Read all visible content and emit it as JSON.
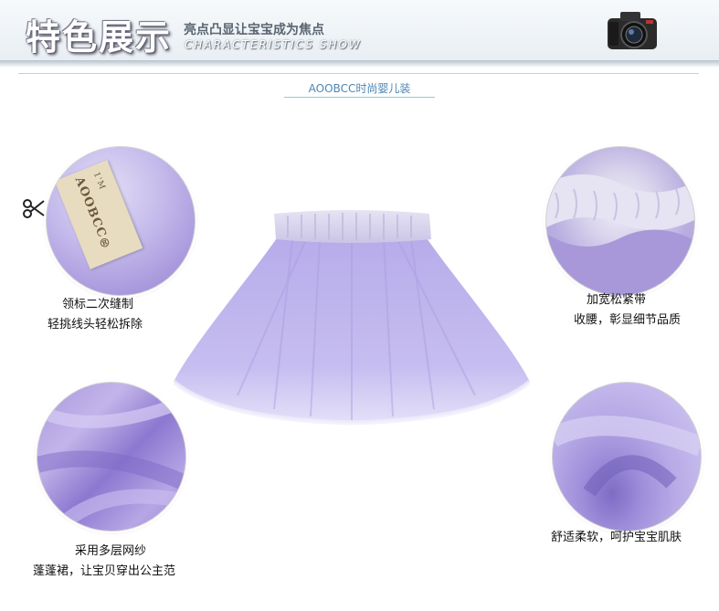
{
  "header": {
    "title": "特色展示",
    "subtitle_cn": "亮点凸显让宝宝成为焦点",
    "subtitle_en": "CHARACTERISTICS SHOW"
  },
  "brand": "AOOBCC时尚婴儿装",
  "label_tag": {
    "brand_text": "AOOBCC®",
    "size_text": "1'M"
  },
  "features": [
    {
      "line1": "领标二次缝制",
      "line2": "轻挑线头轻松拆除"
    },
    {
      "line1": "加宽松紧带",
      "line2": "收腰，彰显细节品质"
    },
    {
      "line1": "采用多层网纱",
      "line2": "蓬蓬裙，让宝贝穿出公主范"
    },
    {
      "line1": "舒适柔软，呵护宝宝肌肤"
    }
  ],
  "colors": {
    "skirt": "#c8bff0",
    "waistband": "#dcd8f0",
    "brand_text": "#4c86b4"
  },
  "icons": [
    "camera-icon",
    "scissors-icon"
  ]
}
